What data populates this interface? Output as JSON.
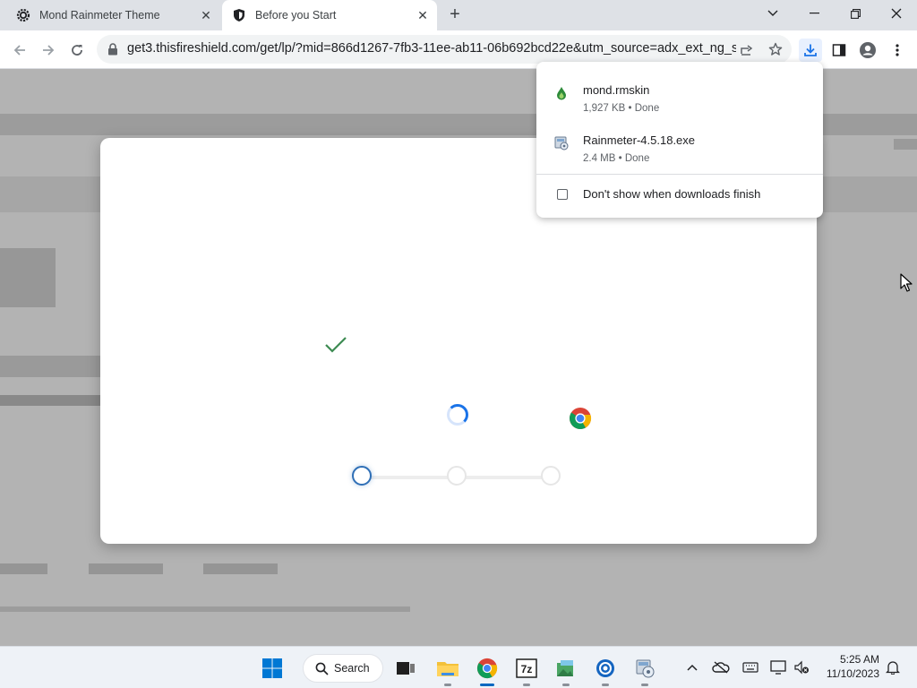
{
  "tabs": [
    {
      "title": "Mond Rainmeter Theme",
      "icon": "gear-icon"
    },
    {
      "title": "Before you Start",
      "icon": "shield-icon"
    }
  ],
  "address_bar": {
    "url": "get3.thisfireshield.com/get/lp/?mid=866d1267-7fb3-11ee-ab11-06b692bcd22e&utm_source=adx_ext_ng_s..."
  },
  "downloads": {
    "items": [
      {
        "name": "mond.rmskin",
        "meta": "1,927 KB • Done",
        "icon": "rainmeter-drop-icon"
      },
      {
        "name": "Rainmeter-4.5.18.exe",
        "meta": "2.4 MB • Done",
        "icon": "installer-icon"
      }
    ],
    "dont_show_label": "Don't show when downloads finish"
  },
  "modal": {
    "progress_steps": 3,
    "active_step": 1
  },
  "taskbar": {
    "search_label": "Search",
    "time": "5:25 AM",
    "date": "11/10/2023"
  },
  "colors": {
    "accent": "#1a73e8",
    "check": "#3d8b52",
    "step_active": "#2f6fb6"
  }
}
